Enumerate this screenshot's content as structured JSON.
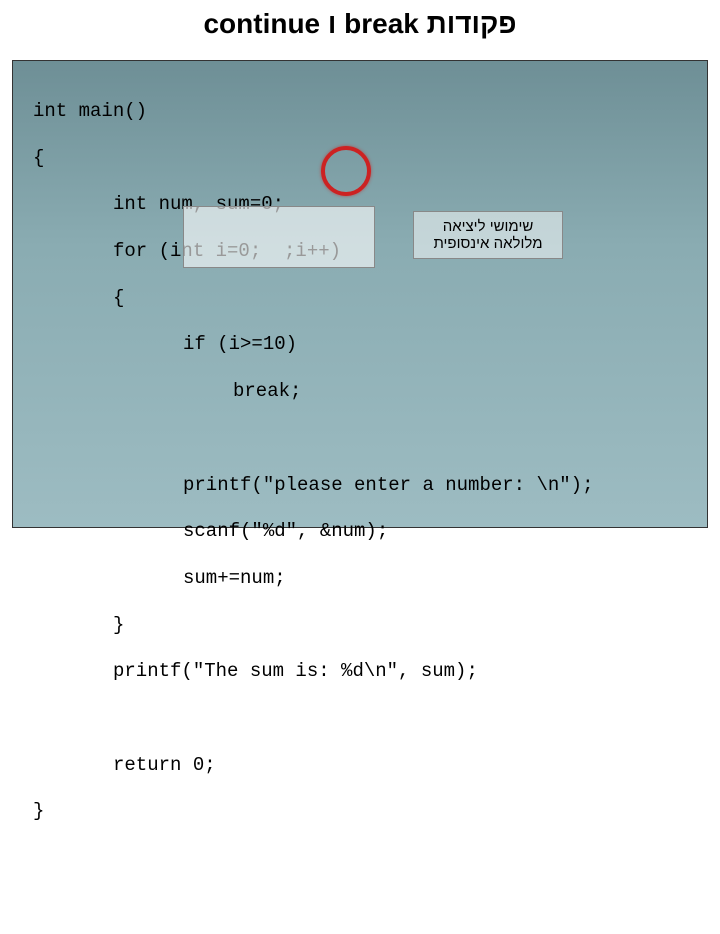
{
  "header": "פקודות break ו continue",
  "code": {
    "l1": "int main()",
    "l2": "{",
    "l3": "int num, sum=0;",
    "l4": "for (int i=0;  ;i++)",
    "l5": "{",
    "l6": "if (i>=10)",
    "l7": "break;",
    "l8": "printf(\"please enter a number: \\n\");",
    "l9": "scanf(\"%d\", &num);",
    "l10": "sum+=num;",
    "l11": "}",
    "l12": "printf(\"The sum is: %d\\n\", sum);",
    "l13": "return 0;",
    "l14": "}"
  },
  "callout": {
    "line1": "שימושי ליציאה",
    "line2": "מלולאה אינסופית"
  }
}
